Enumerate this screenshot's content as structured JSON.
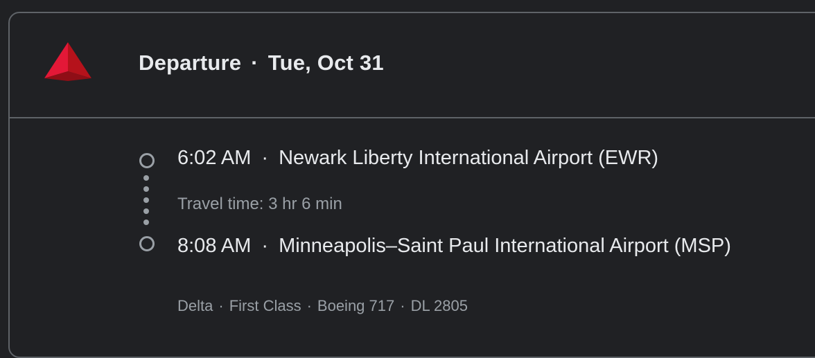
{
  "header": {
    "title": "Departure",
    "date": "Tue, Oct 31",
    "separator": "·",
    "airline_logo": "delta-widget-icon"
  },
  "flight": {
    "departure": {
      "time": "6:02 AM",
      "airport": "Newark Liberty International Airport (EWR)"
    },
    "travel_time": "Travel time: 3 hr 6 min",
    "arrival": {
      "time": "8:08 AM",
      "airport": "Minneapolis–Saint Paul International Airport (MSP)"
    }
  },
  "details": {
    "airline": "Delta",
    "cabin": "First Class",
    "aircraft": "Boeing 717",
    "flight_number": "DL 2805"
  },
  "colors": {
    "background": "#202124",
    "border": "#5f6368",
    "primary_text": "#e8eaed",
    "secondary_text": "#9aa0a6",
    "logo_red": "#c8102e"
  }
}
